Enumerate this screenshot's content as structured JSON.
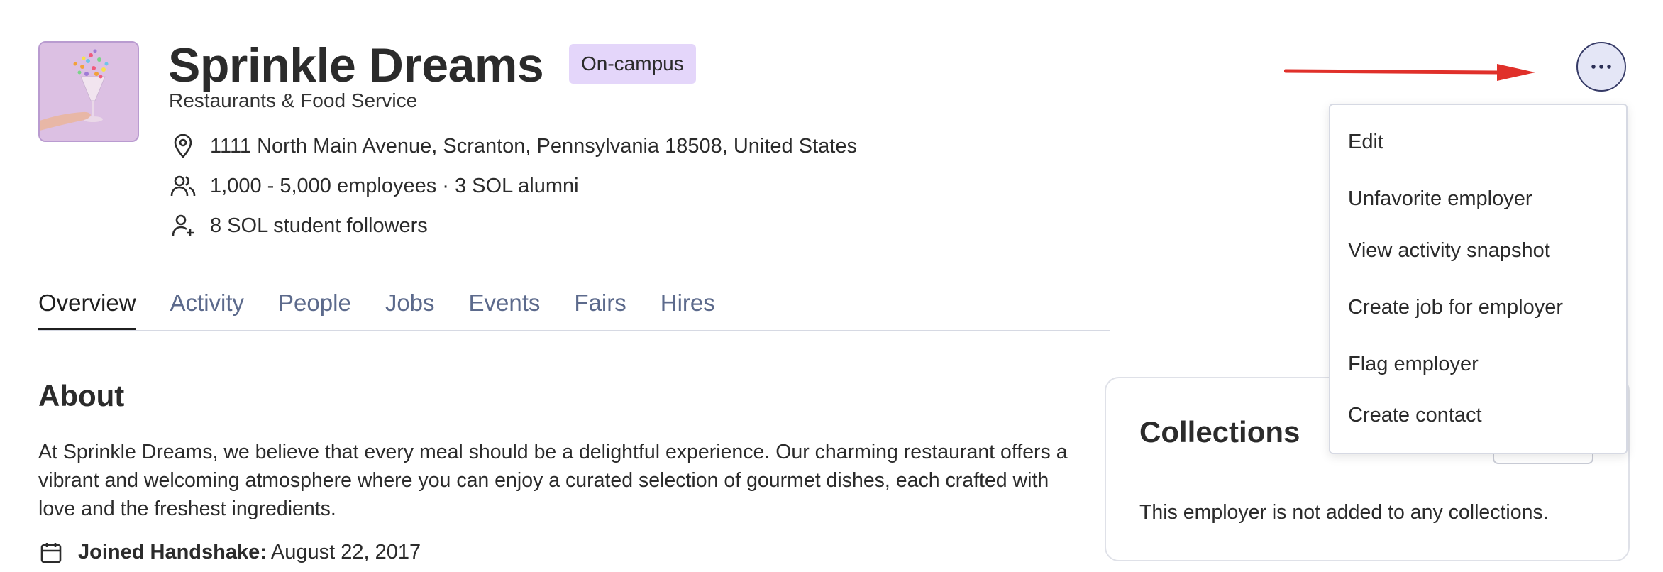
{
  "employer": {
    "name": "Sprinkle Dreams",
    "badge": "On-campus",
    "industry": "Restaurants & Food Service",
    "address": "1111 North Main Avenue, Scranton, Pennsylvania 18508, United States",
    "size": "1,000 - 5,000 employees · 3 SOL alumni",
    "followers": "8 SOL student followers"
  },
  "tabs": [
    {
      "label": "Overview",
      "active": true
    },
    {
      "label": "Activity",
      "active": false
    },
    {
      "label": "People",
      "active": false
    },
    {
      "label": "Jobs",
      "active": false
    },
    {
      "label": "Events",
      "active": false
    },
    {
      "label": "Fairs",
      "active": false
    },
    {
      "label": "Hires",
      "active": false
    }
  ],
  "about": {
    "heading": "About",
    "text": "At Sprinkle Dreams, we believe that every meal should be a delightful experience. Our charming restaurant offers a vibrant and welcoming atmosphere where you can enjoy a curated selection of gourmet dishes, each crafted with love and the freshest ingredients.",
    "joined_label": "Joined Handshake:",
    "joined_date": "August 22, 2017"
  },
  "collections": {
    "heading": "Collections",
    "empty_text": "This employer is not added to any collections."
  },
  "menu": {
    "items": [
      "Edit",
      "Unfavorite employer",
      "View activity snapshot",
      "Create job for employer",
      "Flag employer",
      "Create contact"
    ]
  },
  "colors": {
    "badge_bg": "#e4d6fa",
    "more_button_bg": "#e4e6f6",
    "annotation_arrow": "#e0302a",
    "inactive_tab": "#5c6a8c"
  },
  "icons": {
    "address": "location-pin-icon",
    "size": "people-icon",
    "followers": "user-plus-icon",
    "joined": "calendar-icon",
    "more": "ellipsis-icon"
  }
}
